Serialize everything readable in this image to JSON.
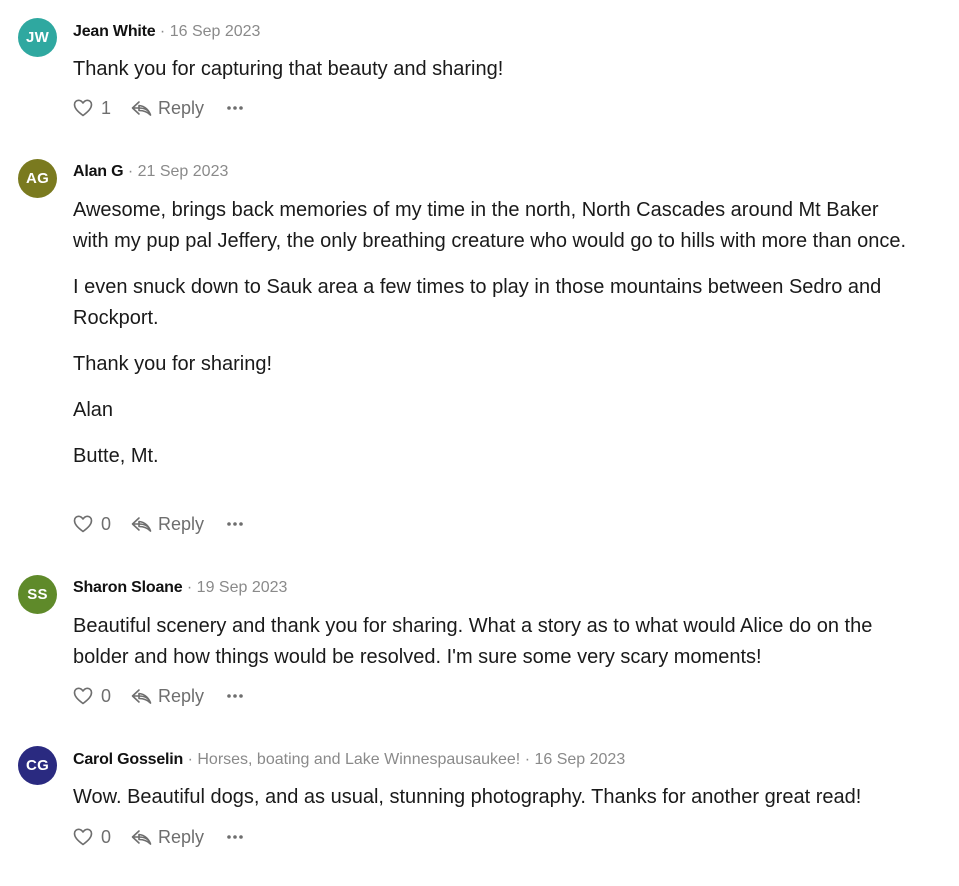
{
  "comments": [
    {
      "initials": "JW",
      "avatar_color": "#2fa8a0",
      "author": "Jean White",
      "tagline": "",
      "date": "16 Sep 2023",
      "paragraphs": [
        "Thank you for capturing that beauty and sharing!"
      ],
      "likes": "1",
      "reply_label": "Reply"
    },
    {
      "initials": "AG",
      "avatar_color": "#7a7a1f",
      "author": "Alan G",
      "tagline": "",
      "date": "21 Sep 2023",
      "paragraphs": [
        "Awesome,  brings back memories of my time in the north, North Cascades around Mt Baker with my pup pal Jeffery, the only breathing creature who would go to hills with more than once.",
        "I even snuck down to Sauk area a few times to play in those mountains between Sedro and Rockport.",
        "Thank you for sharing!",
        "Alan",
        "Butte, Mt."
      ],
      "likes": "0",
      "reply_label": "Reply"
    },
    {
      "initials": "SS",
      "avatar_color": "#5f8a2a",
      "author": "Sharon Sloane",
      "tagline": "",
      "date": "19 Sep 2023",
      "paragraphs": [
        "Beautiful scenery and thank you for sharing. What a story as to what would Alice do on the bolder and how things would be resolved. I'm sure some very scary moments!"
      ],
      "likes": "0",
      "reply_label": "Reply"
    },
    {
      "initials": "CG",
      "avatar_color": "#2a2a80",
      "author": "Carol Gosselin",
      "tagline": "Horses, boating and Lake Winnespausaukee!",
      "date": "16 Sep 2023",
      "paragraphs": [
        "Wow. Beautiful dogs, and as usual, stunning photography. Thanks for another great read!"
      ],
      "likes": "0",
      "reply_label": "Reply"
    }
  ],
  "icons": {
    "like": "heart-icon",
    "reply": "reply-arrow-icon",
    "more": "more-dots-icon"
  },
  "separator": "·"
}
